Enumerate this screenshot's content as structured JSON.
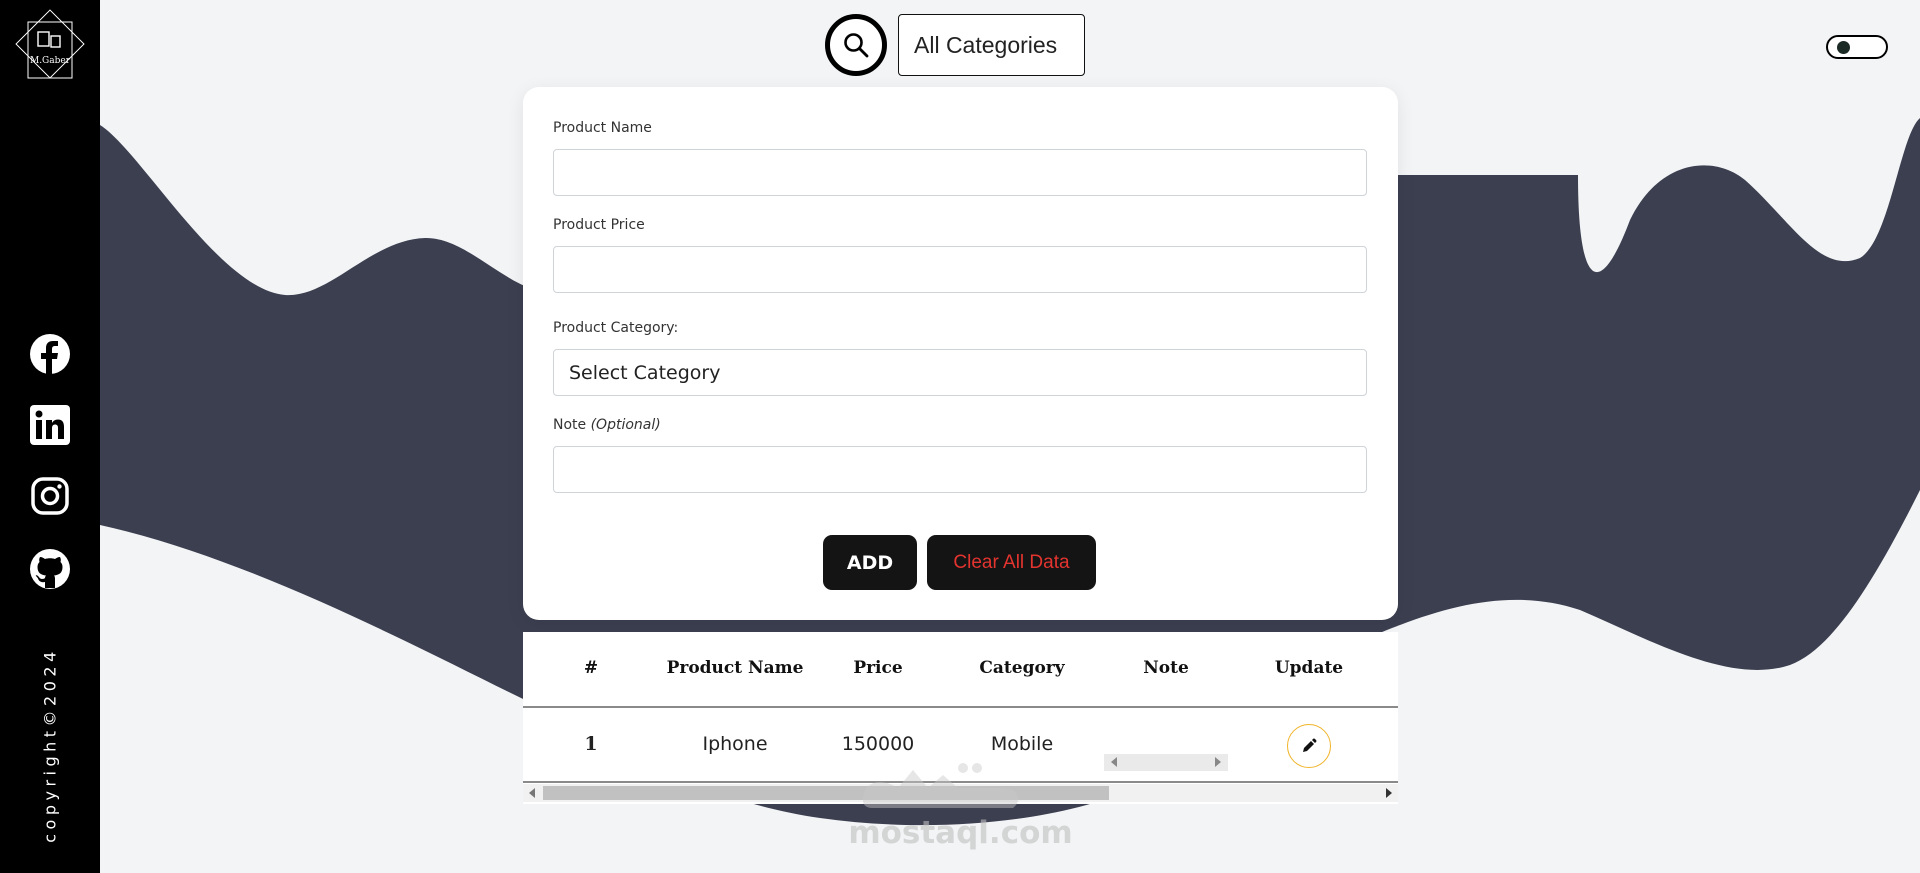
{
  "sidebar": {
    "logo_text": "M.Gaber",
    "social": [
      "facebook-icon",
      "linkedin-icon",
      "instagram-icon",
      "github-icon"
    ],
    "copyright": "copyright©2024"
  },
  "topbar": {
    "category_filter": "All Categories"
  },
  "form": {
    "name_label": "Product Name",
    "price_label": "Product Price",
    "category_label": "Product Category:",
    "category_value": "Select Category",
    "note_label": "Note",
    "note_optional": "(Optional)",
    "add_label": "ADD",
    "clear_label": "Clear All Data"
  },
  "table": {
    "headers": [
      "#",
      "Product Name",
      "Price",
      "Category",
      "Note",
      "Update"
    ],
    "rows": [
      {
        "index": "1",
        "name": "Iphone",
        "price": "150000",
        "category": "Mobile",
        "note": ""
      }
    ]
  },
  "watermark": "mostaql.com",
  "colors": {
    "sidebar": "#000000",
    "wave": "#3b3f4f",
    "clear_text": "#e3342f",
    "edit_border": "#f0b429"
  }
}
